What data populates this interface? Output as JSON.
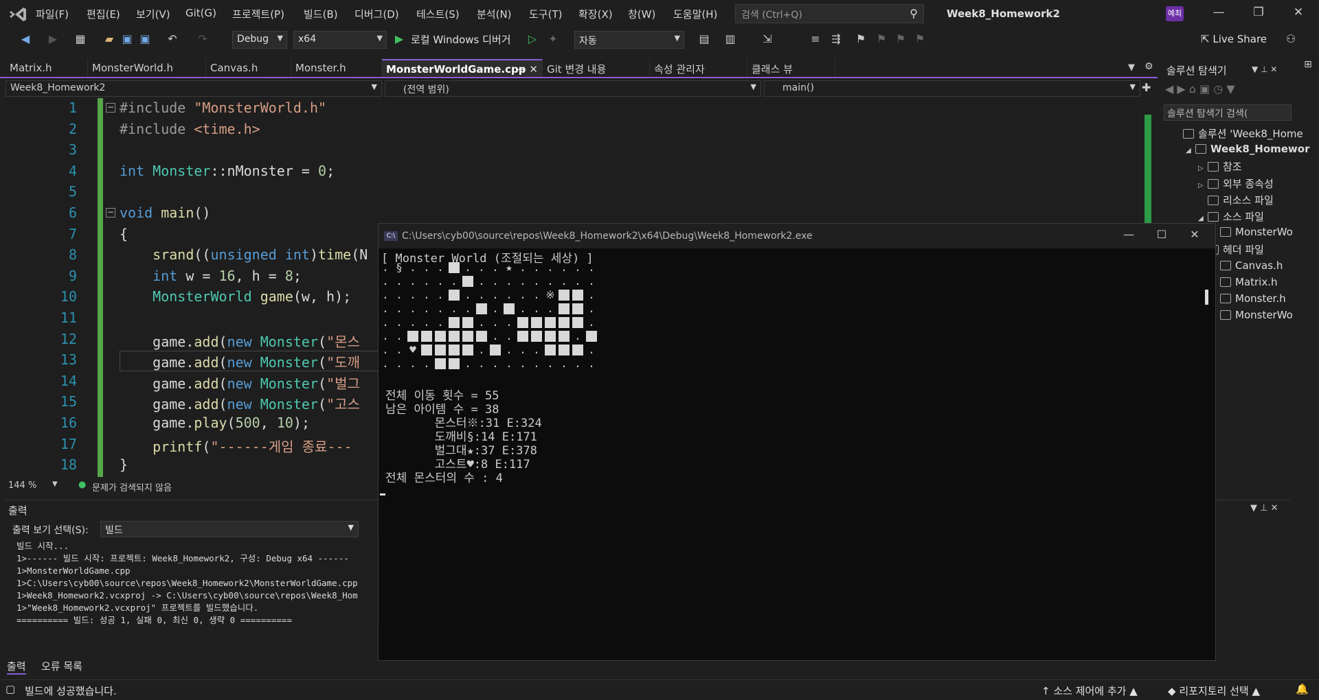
{
  "menu": [
    "파일(F)",
    "편집(E)",
    "보기(V)",
    "Git(G)",
    "프로젝트(P)",
    "빌드(B)",
    "디버그(D)",
    "테스트(S)",
    "분석(N)",
    "도구(T)",
    "확장(X)",
    "창(W)",
    "도움말(H)"
  ],
  "search_placeholder": "검색 (Ctrl+Q)",
  "solution_name": "Week8_Homework2",
  "user_badge": "예최",
  "toolbar": {
    "config": "Debug",
    "platform": "x64",
    "run_label": "로컬 Windows 디버거",
    "mode": "자동",
    "live_share": "Live Share"
  },
  "tabs": [
    "Matrix.h",
    "MonsterWorld.h",
    "Canvas.h",
    "Monster.h",
    "MonsterWorldGame.cpp",
    "Git 변경 내용",
    "속성 관리자",
    "클래스 뷰"
  ],
  "nav": {
    "project": "Week8_Homework2",
    "scope": "(전역 범위)",
    "member": "main()"
  },
  "code_lines": [
    {
      "n": "1",
      "tokens": [
        [
          "pp",
          "#include "
        ],
        [
          "str",
          "\"MonsterWorld.h\""
        ]
      ]
    },
    {
      "n": "2",
      "tokens": [
        [
          "pp",
          "#include "
        ],
        [
          "str",
          "<time.h>"
        ]
      ]
    },
    {
      "n": "3",
      "tokens": []
    },
    {
      "n": "4",
      "tokens": [
        [
          "kw",
          "int "
        ],
        [
          "ty",
          "Monster"
        ],
        [
          "var",
          "::nMonster = "
        ],
        [
          "num",
          "0"
        ],
        [
          "var",
          ";"
        ]
      ]
    },
    {
      "n": "5",
      "tokens": []
    },
    {
      "n": "6",
      "tokens": [
        [
          "kw",
          "void "
        ],
        [
          "fn",
          "main"
        ],
        [
          "var",
          "()"
        ]
      ]
    },
    {
      "n": "7",
      "tokens": [
        [
          "var",
          "{"
        ]
      ]
    },
    {
      "n": "8",
      "tokens": [
        [
          "fn",
          "    srand"
        ],
        [
          "var",
          "(("
        ],
        [
          "kw",
          "unsigned int"
        ],
        [
          "var",
          ")"
        ],
        [
          "fn",
          "time"
        ],
        [
          "var",
          "(N"
        ]
      ]
    },
    {
      "n": "9",
      "tokens": [
        [
          "kw",
          "    int "
        ],
        [
          "var",
          "w = "
        ],
        [
          "num",
          "16"
        ],
        [
          "var",
          ", h = "
        ],
        [
          "num",
          "8"
        ],
        [
          "var",
          ";"
        ]
      ]
    },
    {
      "n": "10",
      "tokens": [
        [
          "ty",
          "    MonsterWorld "
        ],
        [
          "fn",
          "game"
        ],
        [
          "var",
          "(w, h);"
        ]
      ]
    },
    {
      "n": "11",
      "tokens": []
    },
    {
      "n": "12",
      "tokens": [
        [
          "var",
          "    game."
        ],
        [
          "fn",
          "add"
        ],
        [
          "var",
          "("
        ],
        [
          "kw",
          "new "
        ],
        [
          "ty",
          "Monster"
        ],
        [
          "var",
          "("
        ],
        [
          "str",
          "\"몬스"
        ]
      ]
    },
    {
      "n": "13",
      "tokens": [
        [
          "var",
          "    game."
        ],
        [
          "fn",
          "add"
        ],
        [
          "var",
          "("
        ],
        [
          "kw",
          "new "
        ],
        [
          "ty",
          "Monster"
        ],
        [
          "var",
          "("
        ],
        [
          "str",
          "\"도깨"
        ]
      ]
    },
    {
      "n": "14",
      "tokens": [
        [
          "var",
          "    game."
        ],
        [
          "fn",
          "add"
        ],
        [
          "var",
          "("
        ],
        [
          "kw",
          "new "
        ],
        [
          "ty",
          "Monster"
        ],
        [
          "var",
          "("
        ],
        [
          "str",
          "\"벌그"
        ]
      ]
    },
    {
      "n": "15",
      "tokens": [
        [
          "var",
          "    game."
        ],
        [
          "fn",
          "add"
        ],
        [
          "var",
          "("
        ],
        [
          "kw",
          "new "
        ],
        [
          "ty",
          "Monster"
        ],
        [
          "var",
          "("
        ],
        [
          "str",
          "\"고스"
        ]
      ]
    },
    {
      "n": "16",
      "tokens": [
        [
          "var",
          "    game."
        ],
        [
          "fn",
          "play"
        ],
        [
          "var",
          "("
        ],
        [
          "num",
          "500"
        ],
        [
          "var",
          ", "
        ],
        [
          "num",
          "10"
        ],
        [
          "var",
          ");"
        ]
      ]
    },
    {
      "n": "17",
      "tokens": [
        [
          "fn",
          "    printf"
        ],
        [
          "var",
          "("
        ],
        [
          "str",
          "\"------게임 종료---"
        ]
      ]
    },
    {
      "n": "18",
      "tokens": [
        [
          "var",
          "}"
        ]
      ]
    }
  ],
  "editor_status": {
    "zoom": "144 %",
    "issues": "문제가 검색되지 않음"
  },
  "output": {
    "title": "출력",
    "source_label": "출력 보기 선택(S):",
    "source_value": "빌드",
    "lines": [
      "빌드 시작...",
      "1>------ 빌드 시작: 프로젝트: Week8_Homework2, 구성: Debug x64 ------",
      "1>MonsterWorldGame.cpp",
      "1>C:\\Users\\cyb00\\source\\repos\\Week8_Homework2\\MonsterWorldGame.cpp",
      "1>Week8_Homework2.vcxproj -> C:\\Users\\cyb00\\source\\repos\\Week8_Hom",
      "1>\"Week8_Homework2.vcxproj\" 프로젝트를 빌드했습니다.",
      "========== 빌드: 성공 1, 실패 0, 최신 0, 생략 0 =========="
    ]
  },
  "bottom_tabs": [
    "출력",
    "오류 목록"
  ],
  "solution_explorer": {
    "title": "솔루션 탐색기",
    "search_placeholder": "솔루션 탐색기 검색(",
    "items": [
      "솔루션 'Week8_Home",
      "Week8_Homewor",
      "참조",
      "외부 종속성",
      "리소스 파일",
      "소스 파일",
      "MonsterWo",
      "헤더 파일",
      "Canvas.h",
      "Matrix.h",
      "Monster.h",
      "MonsterWo"
    ]
  },
  "statusbar": {
    "message": "빌드에 성공했습니다.",
    "source_control": "소스 제어에 추가",
    "repo": "리포지토리 선택"
  },
  "console": {
    "title": "C:\\Users\\cyb00\\source\\repos\\Week8_Homework2\\x64\\Debug\\Week8_Homework2.exe",
    "header": "[ Monster World (조절되는 세상) ]",
    "grid": [
      ". § . . . ■ . . . ★ . . . . . .",
      ". . . . . . ■ . . . . . . . . .",
      ". . . . . ■ . . . . . . ※ ■ ■ .",
      ". . . . . . . ■ . ■ . . . ■ ■ .",
      ". . . . . ■ ■ . . . ■ ■ ■ ■ ■ .",
      ". . ■ ■ ■ ■ ■ ■ . . ■ ■ ■ ■ . ■",
      ". . ♥ ■ ■ ■ ■ . ■ . . . ■ ■ ■ .",
      ". . . . ■ ■ . . . . . . . . . ."
    ],
    "stats": [
      "전체 이동 횟수 = 55",
      "남은 아이템 수 = 38",
      "       몬스터※:31 E:324",
      "       도깨비§:14 E:171",
      "       벌그대★:37 E:378",
      "       고스트♥:8 E:117",
      "전체 몬스터의 수 : 4"
    ]
  }
}
